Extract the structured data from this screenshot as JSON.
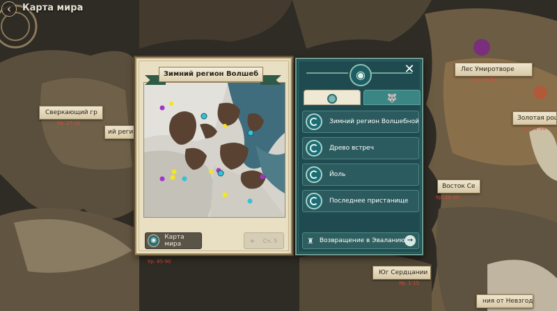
{
  "header": {
    "title": "Карта мира",
    "help": "?"
  },
  "map_regions": [
    {
      "name": "Сверкающий гр",
      "level": "Ур. 27-31"
    },
    {
      "name": "ий реги",
      "level": ""
    },
    {
      "name": "Лес Умиротворе",
      "level": "Ур. 40-48"
    },
    {
      "name": "Золотая рощ",
      "level": "Ур. 31-34"
    },
    {
      "name": "Восток Се",
      "level": "Ур. 16-20"
    },
    {
      "name": "Юг Сердцании",
      "level": "Ур. 1-15"
    },
    {
      "name": "ния от Невзгод",
      "level": ""
    },
    {
      "name": "",
      "level": "Ур. 85-90"
    }
  ],
  "region_dialog": {
    "title": "Зимний регион Волшеб",
    "world_map_button": "Карта мира",
    "locate_button": "Сч. 5"
  },
  "locations_dialog": {
    "close": "✕",
    "tabs": [
      "",
      ""
    ],
    "locations": [
      {
        "label": "Зимний регион Волшебной ст"
      },
      {
        "label": "Древо встреч"
      },
      {
        "label": "Йоль"
      },
      {
        "label": "Последнее пристанище"
      }
    ],
    "return_button": "Возвращение в Эваланию"
  },
  "colors": {
    "dialog_teal": "#1f4b50",
    "parchment": "#e9dfc3",
    "marker_yellow": "#f5e51c",
    "marker_purple": "#a434c8",
    "marker_cyan": "#35c2d6"
  },
  "icons": {
    "back": "back-arrow-icon",
    "close": "close-icon",
    "globe": "globe-icon",
    "portal": "portal-icon",
    "castle": "castle-icon",
    "arrow": "arrow-right-icon",
    "crosshair": "crosshair-icon"
  }
}
